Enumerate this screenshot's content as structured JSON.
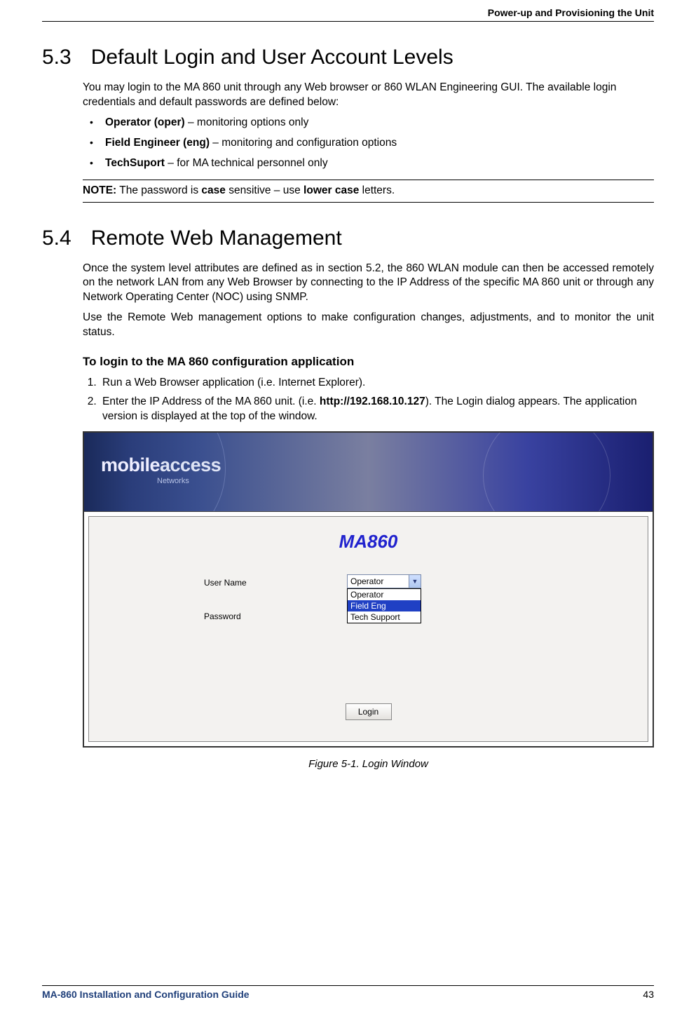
{
  "header": {
    "title": "Power-up and Provisioning the Unit"
  },
  "section53": {
    "num": "5.3",
    "title": "Default Login and User Account Levels",
    "intro": "You may login to the MA 860 unit through any Web browser or 860 WLAN Engineering GUI. The available login credentials and default passwords are defined below:",
    "bullets": [
      {
        "bold": "Operator (oper)",
        "rest": " – monitoring options only"
      },
      {
        "bold": "Field Engineer (eng)",
        "rest": " – monitoring and configuration options"
      },
      {
        "bold": "TechSuport",
        "rest": " – for MA technical personnel only"
      }
    ],
    "note": {
      "label": "NOTE:",
      "t1": " The password is ",
      "bold1": "case",
      "t2": " sensitive – use ",
      "bold2": "lower case",
      "t3": " letters."
    }
  },
  "section54": {
    "num": "5.4",
    "title": "Remote Web Management",
    "p1": "Once the system level attributes are defined as in section 5.2, the 860 WLAN module can then be accessed remotely on the network LAN from any Web Browser by connecting to the IP Address of the specific MA 860 unit or through any Network Operating Center (NOC) using SNMP.",
    "p2": "Use the Remote Web management options to make configuration changes, adjustments, and to monitor the unit status.",
    "subhead": "To login to the MA 860 configuration application",
    "step1": "Run a Web Browser application (i.e. Internet Explorer).",
    "step2a": "Enter the IP Address of the MA 860 unit.  (i.e. ",
    "step2url": "http://192.168.10.127",
    "step2b": "). The Login dialog appears. The application version is displayed at the top of the window."
  },
  "login_figure": {
    "brand_main": "mobile",
    "brand_main2": "access",
    "brand_sub": "Networks",
    "app_title": "MA860",
    "label_user": "User Name",
    "label_pass": "Password",
    "selected_value": "Operator",
    "options": [
      "Operator",
      "Field Eng",
      "Tech Support"
    ],
    "selected_option": "Field Eng",
    "login_button": "Login",
    "caption": "Figure 5-1. Login Window"
  },
  "footer": {
    "guide": "MA-860 Installation and Configuration Guide",
    "page": "43"
  }
}
